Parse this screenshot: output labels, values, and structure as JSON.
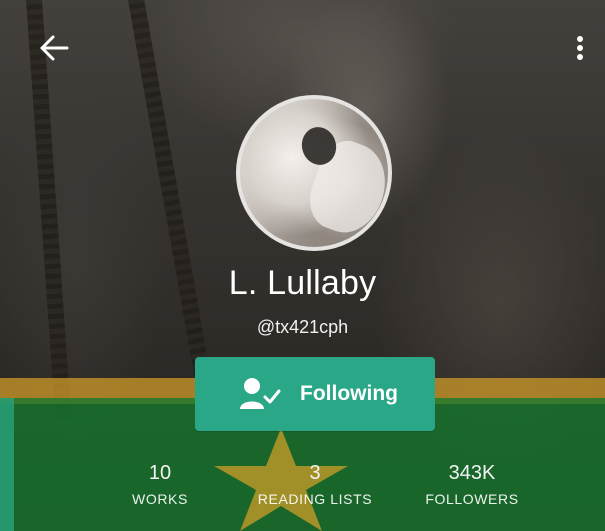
{
  "header": {
    "back_icon": "arrow-left-icon",
    "menu_icon": "more-vertical-icon"
  },
  "profile": {
    "name": "L. Lullaby",
    "handle": "@tx421cph",
    "avatar_icon": "profile-photo"
  },
  "follow_button": {
    "label": "Following",
    "icon": "person-check-icon",
    "color": "#2aa786"
  },
  "stats": [
    {
      "value": "10",
      "label": "WORKS"
    },
    {
      "value": "3",
      "label": "READING LISTS"
    },
    {
      "value": "343K",
      "label": "FOLLOWERS"
    }
  ],
  "overlay_colors": {
    "gold": "#d6a028",
    "green": "#16782d",
    "star": "#d6a028"
  }
}
